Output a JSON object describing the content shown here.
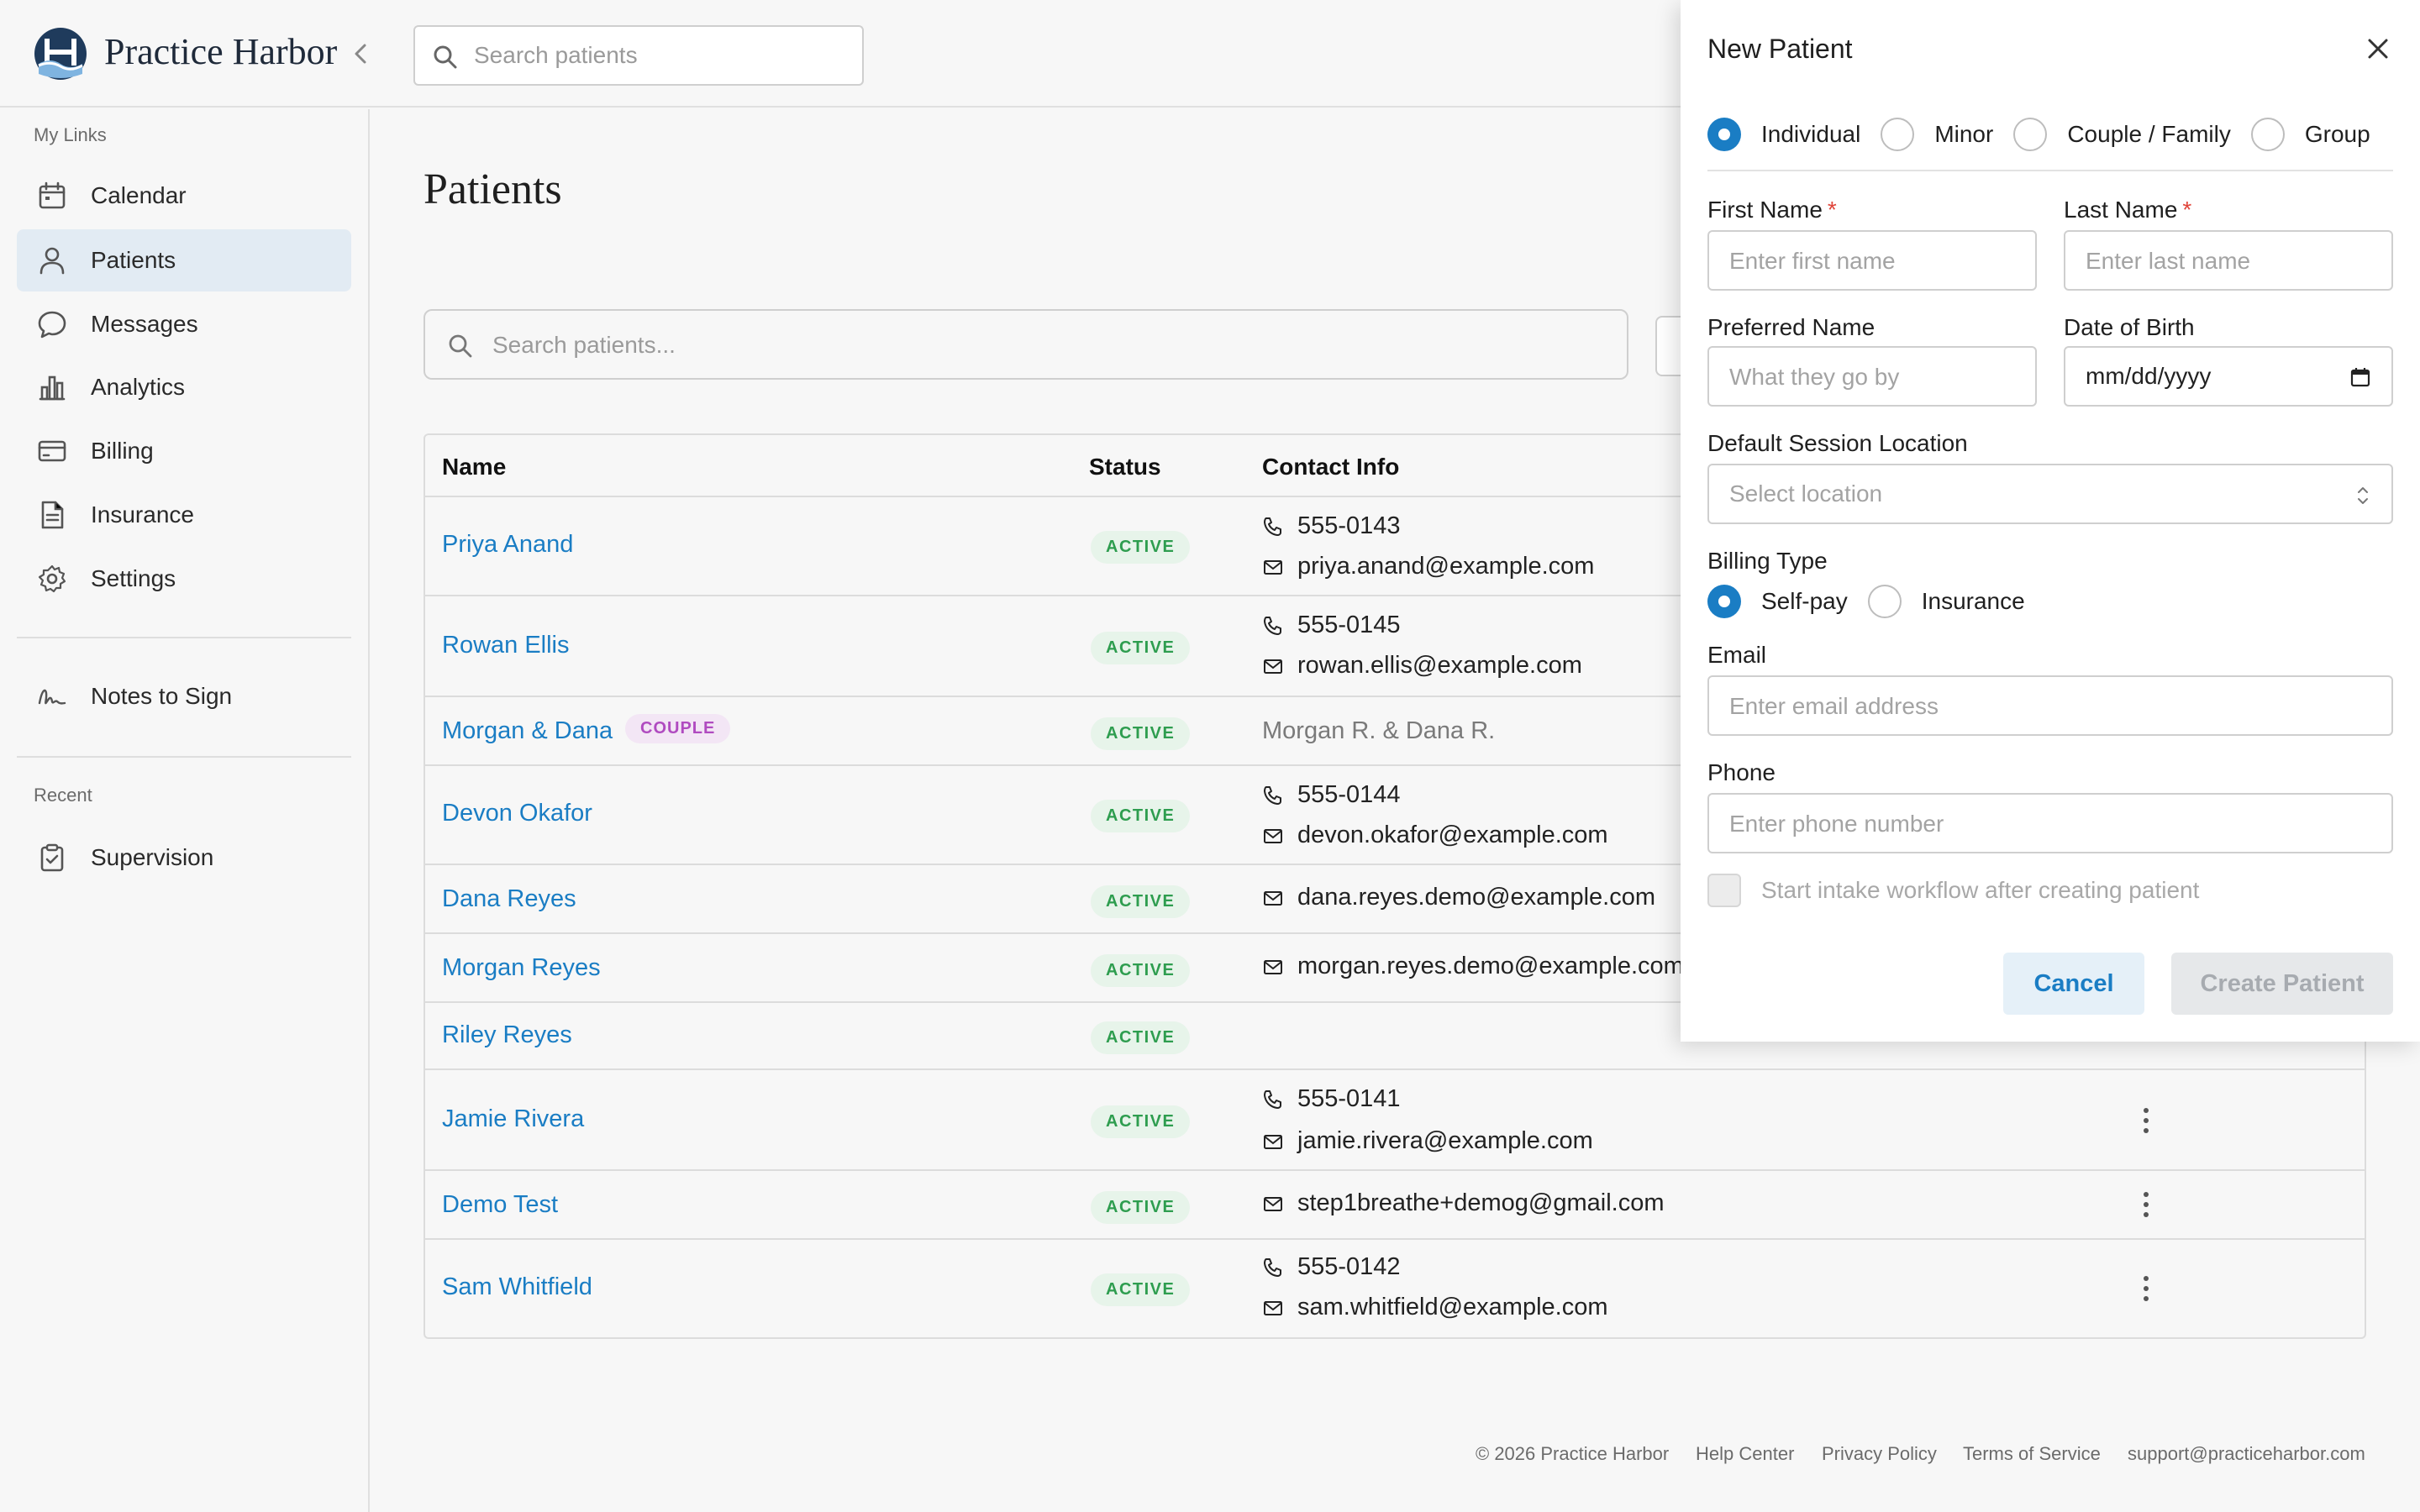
{
  "app": {
    "brand": "Practice Harbor"
  },
  "topbar": {
    "search_placeholder": "Search patients"
  },
  "sidebar": {
    "section_my_links": "My Links",
    "items": [
      {
        "label": "Calendar",
        "icon": "calendar-icon"
      },
      {
        "label": "Patients",
        "icon": "person-icon",
        "active": true
      },
      {
        "label": "Messages",
        "icon": "chat-bubble-icon"
      },
      {
        "label": "Analytics",
        "icon": "bar-chart-icon"
      },
      {
        "label": "Billing",
        "icon": "credit-card-icon"
      },
      {
        "label": "Insurance",
        "icon": "document-icon"
      },
      {
        "label": "Settings",
        "icon": "gear-icon"
      }
    ],
    "notes_to_sign": "Notes to Sign",
    "section_recent": "Recent",
    "recent_items": [
      {
        "label": "Supervision",
        "icon": "clipboard-check-icon"
      }
    ]
  },
  "main": {
    "title": "Patients",
    "search_placeholder": "Search patients...",
    "table": {
      "columns": [
        "Name",
        "Status",
        "Contact Info"
      ],
      "rows": [
        {
          "name": "Priya Anand",
          "status": "ACTIVE",
          "phone": "555-0143",
          "email": "priya.anand@example.com"
        },
        {
          "name": "Rowan Ellis",
          "status": "ACTIVE",
          "phone": "555-0145",
          "email": "rowan.ellis@example.com"
        },
        {
          "name": "Morgan & Dana",
          "tag": "COUPLE",
          "status": "ACTIVE",
          "contact_text": "Morgan R. & Dana R."
        },
        {
          "name": "Devon Okafor",
          "status": "ACTIVE",
          "phone": "555-0144",
          "email": "devon.okafor@example.com"
        },
        {
          "name": "Dana Reyes",
          "status": "ACTIVE",
          "email": "dana.reyes.demo@example.com"
        },
        {
          "name": "Morgan Reyes",
          "status": "ACTIVE",
          "email": "morgan.reyes.demo@example.com"
        },
        {
          "name": "Riley Reyes",
          "status": "ACTIVE"
        },
        {
          "name": "Jamie Rivera",
          "status": "ACTIVE",
          "phone": "555-0141",
          "email": "jamie.rivera@example.com"
        },
        {
          "name": "Demo Test",
          "status": "ACTIVE",
          "email": "step1breathe+demog@gmail.com"
        },
        {
          "name": "Sam Whitfield",
          "status": "ACTIVE",
          "phone": "555-0142",
          "email": "sam.whitfield@example.com"
        }
      ]
    }
  },
  "footer": {
    "copyright": "© 2026 Practice Harbor",
    "help": "Help Center",
    "privacy": "Privacy Policy",
    "terms": "Terms of Service",
    "support": "support@practiceharbor.com"
  },
  "panel": {
    "title": "New Patient",
    "patient_types": [
      "Individual",
      "Minor",
      "Couple / Family",
      "Group"
    ],
    "selected_type": "Individual",
    "first_name_label": "First Name",
    "first_name_placeholder": "Enter first name",
    "last_name_label": "Last Name",
    "last_name_placeholder": "Enter last name",
    "required_mark": "*",
    "preferred_name_label": "Preferred Name",
    "preferred_name_placeholder": "What they go by",
    "dob_label": "Date of Birth",
    "dob_value": "mm/dd/yyyy",
    "location_label": "Default Session Location",
    "location_placeholder": "Select location",
    "billing_label": "Billing Type",
    "billing_options": [
      "Self-pay",
      "Insurance"
    ],
    "billing_selected": "Self-pay",
    "email_label": "Email",
    "email_placeholder": "Enter email address",
    "phone_label": "Phone",
    "phone_placeholder": "Enter phone number",
    "intake_label": "Start intake workflow after creating patient",
    "cancel_label": "Cancel",
    "create_label": "Create Patient"
  },
  "colors": {
    "accent": "#1a7dc4",
    "active_badge": "#2e9d4f",
    "couple_badge": "#b04bc0",
    "required": "#e0453a"
  }
}
